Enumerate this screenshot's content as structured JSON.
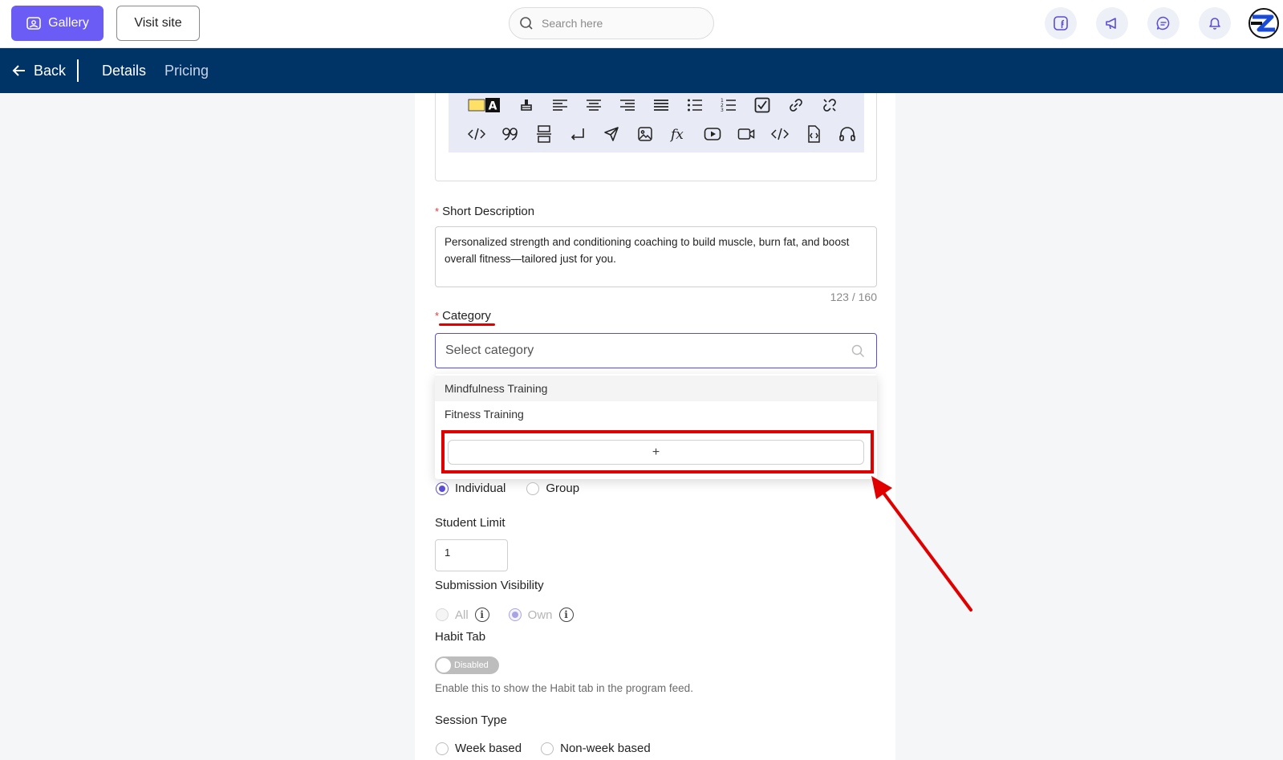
{
  "topbar": {
    "gallery_label": "Gallery",
    "visit_site_label": "Visit site",
    "search_placeholder": "Search here",
    "icons": [
      "facebook-icon",
      "megaphone-icon",
      "chat-icon",
      "bell-icon",
      "brand-logo"
    ]
  },
  "nav": {
    "back_label": "Back",
    "tabs": [
      {
        "label": "Details",
        "active": true
      },
      {
        "label": "Pricing",
        "active": false
      }
    ]
  },
  "editor": {
    "toolbar_row1": [
      "highlight-color-icon",
      "text-color-icon",
      "clear-format-icon",
      "align-left-icon",
      "align-center-icon",
      "align-right-icon",
      "justify-icon",
      "bullet-list-icon",
      "numbered-list-icon",
      "checklist-icon",
      "link-icon",
      "unlink-icon"
    ],
    "toolbar_row2": [
      "code-icon",
      "quote-icon",
      "page-break-icon",
      "line-break-icon",
      "send-icon",
      "image-icon",
      "formula-icon",
      "youtube-icon",
      "video-icon",
      "embed-code-icon",
      "file-code-icon",
      "audio-icon"
    ]
  },
  "form": {
    "short_description": {
      "label": "Short Description",
      "value": "Personalized strength and conditioning coaching to build muscle, burn fat, and boost overall fitness—tailored just for you.",
      "counter": "123 / 160"
    },
    "category": {
      "label": "Category",
      "placeholder": "Select category",
      "options": [
        "Mindfulness Training",
        "Fitness Training"
      ],
      "add_label": "+"
    },
    "mode": {
      "options": [
        "Individual",
        "Group"
      ],
      "selected": "Individual"
    },
    "student_limit": {
      "label": "Student Limit",
      "value": "1"
    },
    "submission_visibility": {
      "label": "Submission Visibility",
      "options": [
        "All",
        "Own"
      ],
      "selected": "Own",
      "info_glyph": "i"
    },
    "habit_tab": {
      "label": "Habit Tab",
      "toggle_label": "Disabled",
      "help": "Enable this to show the Habit tab in the program feed."
    },
    "session_type": {
      "label": "Session Type",
      "options": [
        "Week based",
        "Non-week based"
      ]
    }
  },
  "colors": {
    "accent": "#6a5cf5",
    "nav_bg": "#003366",
    "annotation": "#e00000"
  }
}
